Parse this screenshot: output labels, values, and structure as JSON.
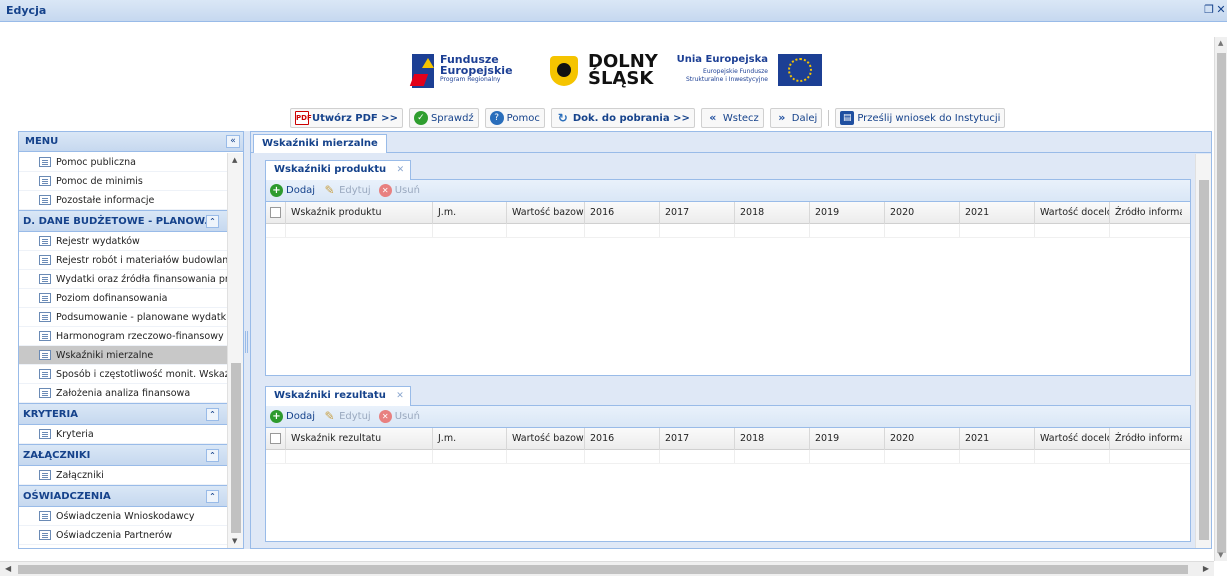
{
  "window": {
    "title": "Edycja",
    "restore_icon": "restore-icon",
    "close_icon": "close-icon"
  },
  "logos": {
    "fe_line1": "Fundusze",
    "fe_line2": "Europejskie",
    "fe_line3": "Program Regionalny",
    "ds_line1": "DOLNY",
    "ds_line2": "ŚLĄSK",
    "ue_line1": "Unia Europejska",
    "ue_line2": "Europejskie Fundusze",
    "ue_line3": "Strukturalne i Inwestycyjne"
  },
  "toolbar": {
    "pdf": "Utwórz PDF >>",
    "check": "Sprawdź",
    "help": "Pomoc",
    "download": "Dok. do pobrania >>",
    "back": "Wstecz",
    "next": "Dalej",
    "send": "Prześlij wniosek do Instytucji"
  },
  "menu": {
    "title": "MENU",
    "group_top": [
      "Pomoc publiczna",
      "Pomoc de minimis",
      "Pozostałe informacje"
    ],
    "section_d": {
      "title": "D. DANE BUDŻETOWE - PLANOW...",
      "items": [
        "Rejestr wydatków",
        "Rejestr robót i materiałów budowlanyc",
        "Wydatki oraz źródła finansowania proj",
        "Poziom dofinansowania",
        "Podsumowanie - planowane wydatki w",
        "Harmonogram rzeczowo-finansowy",
        "Wskaźniki mierzalne",
        "Sposób i częstotliwość monit. Wskaźni",
        "Założenia analiza finansowa"
      ],
      "active_index": 6
    },
    "section_kryteria": {
      "title": "KRYTERIA",
      "items": [
        "Kryteria"
      ]
    },
    "section_zalaczniki": {
      "title": "ZAŁĄCZNIKI",
      "items": [
        "Załączniki"
      ]
    },
    "section_oswiadczenia": {
      "title": "OŚWIADCZENIA",
      "items": [
        "Oświadczenia Wnioskodawcy",
        "Oświadczenia Partnerów"
      ]
    }
  },
  "main": {
    "tab": "Wskaźniki mierzalne",
    "product": {
      "tab": "Wskaźniki produktu",
      "add": "Dodaj",
      "edit": "Edytuj",
      "delete": "Usuń",
      "columns": [
        "Wskaźnik produktu",
        "J.m.",
        "Wartość bazowa",
        "2016",
        "2017",
        "2018",
        "2019",
        "2020",
        "2021",
        "Wartość docelow",
        "Źródło informac"
      ]
    },
    "result": {
      "tab": "Wskaźniki rezultatu",
      "add": "Dodaj",
      "edit": "Edytuj",
      "delete": "Usuń",
      "columns": [
        "Wskaźnik rezultatu",
        "J.m.",
        "Wartość bazowa",
        "2016",
        "2017",
        "2018",
        "2019",
        "2020",
        "2021",
        "Wartość docelow",
        "Źródło informac"
      ]
    }
  }
}
